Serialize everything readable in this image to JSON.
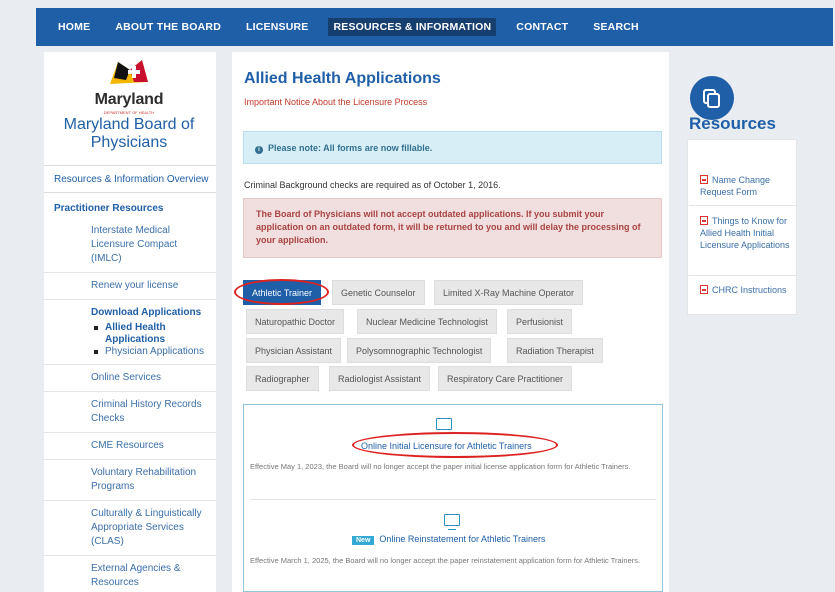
{
  "nav": {
    "items": [
      "HOME",
      "ABOUT THE BOARD",
      "LICENSURE",
      "RESOURCES & INFORMATION",
      "CONTACT",
      "SEARCH"
    ],
    "active_index": 3
  },
  "brand": {
    "state": "Maryland",
    "dept": "DEPARTMENT OF HEALTH",
    "board": "Maryland Board of Physicians"
  },
  "sidebar": {
    "top_link": "Resources & Information Overview",
    "section_head": "Practitioner Resources",
    "items": [
      "Interstate Medical Licensure Compact (IMLC)",
      "Renew your license",
      "Download Applications",
      "Online Services",
      "Criminal History Records Checks",
      "CME Resources",
      "Voluntary Rehabilitation Programs",
      "Culturally & Linguistically Appropriate Services (CLAS)",
      "External Agencies & Resources"
    ],
    "sub_items": [
      "Allied Health Applications",
      "Physician Applications"
    ]
  },
  "main": {
    "title": "Allied Health Applications",
    "notice_link": "Important Notice About the Licensure Process",
    "info": "Please note: All forms are now fillable.",
    "bg_check": "Criminal Background checks are required as of October 1, 2016.",
    "warning": "The Board of Physicians will not accept outdated applications. If you submit your application on an outdated form, it will be returned to you and will delay the processing of your application.",
    "pills": [
      "Athletic Trainer",
      "Genetic Counselor",
      "Limited X-Ray Machine Operator",
      "Naturopathic Doctor",
      "Nuclear Medicine Technologist",
      "Perfusionist",
      "Physician Assistant",
      "Polysomnographic Technologist",
      "Radiation Therapist",
      "Radiographer",
      "Radiologist Assistant",
      "Respiratory Care Practitioner"
    ],
    "card": {
      "link1": "Online Initial Licensure for Athletic Trainers",
      "text1": "Effective May 1, 2023, the Board will no longer accept the paper initial license application form for Athletic Trainers.",
      "badge": "New",
      "link2": "Online Reinstatement for Athletic Trainers",
      "text2": "Effective March 1, 2025, the Board will no longer accept the paper reinstatement application form for Athletic Trainers."
    }
  },
  "resources": {
    "title": "Resources",
    "items": [
      "Name Change Request Form",
      "Things to Know for Allied Health Initial Licensure Applications",
      "CHRC Instructions"
    ]
  },
  "colors": {
    "brand_blue": "#1f5fa8",
    "highlight_red": "#d22"
  }
}
